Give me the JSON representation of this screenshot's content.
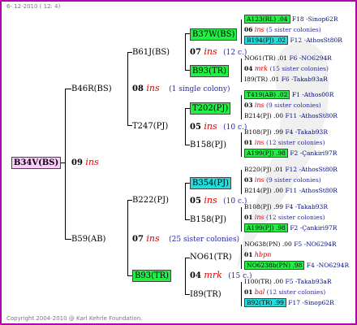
{
  "header": "6- 12-2010 ( 12: 4)",
  "footer": "Copyright 2004-2010 @ Karl Kehrle Foundation.",
  "root": {
    "id": "B34V(BS)",
    "gen": "09",
    "mark": "ins"
  },
  "l1": [
    {
      "id": "B46R(BS)",
      "gen": "08",
      "mark": "ins",
      "note": "(1 single colony)"
    },
    {
      "id": "B59(AB)",
      "gen": "07",
      "mark": "ins",
      "note": "(25 sister colonies)"
    }
  ],
  "l2": [
    {
      "id": "B61J(BS)",
      "gen": "07",
      "mark": "ins",
      "note": "(12 c.)"
    },
    {
      "id": "T247(PJ)",
      "gen": "05",
      "mark": "ins",
      "note": "(10 c.)"
    },
    {
      "id": "B222(PJ)",
      "gen": "05",
      "mark": "ins",
      "note": "(10 c.)"
    },
    {
      "id": "B93(TR)",
      "gen": "04",
      "mark": "mrk",
      "note": "(15 c.)"
    }
  ],
  "l3": [
    {
      "id": "B37W(BS)"
    },
    {
      "id": "B93(TR)"
    },
    {
      "id": "T202(PJ)"
    },
    {
      "id": "B158(PJ)"
    },
    {
      "id": "B354(PJ)"
    },
    {
      "id": "B158(PJ)"
    },
    {
      "id": "NO61(TR)"
    },
    {
      "id": "I89(TR)"
    }
  ],
  "l4": [
    {
      "a": "A123(RL) .04",
      "b": "F18 -Sinop62R",
      "gen": "06",
      "mark": "ins",
      "note": "(5 sister colonies)",
      "c": "B194(PJ) .02",
      "d": "F12 -AthosSt80R"
    },
    {
      "a": "NO61(TR) .01",
      "b": "F6 -NO6294R",
      "gen": "04",
      "mark": "mrk",
      "note": "(15 sister colonies)",
      "c": "I89(TR) .01",
      "d": "F6 -Takab93aR"
    },
    {
      "a": "T419(AB) .02",
      "b": "F1 -Athos00R",
      "gen": "03",
      "mark": "ins",
      "note": "(9 sister colonies)",
      "c": "B214(PJ) .00",
      "d": "F11 -AthosSt80R"
    },
    {
      "a": "B108(PJ) .99",
      "b": "F4 -Takab93R",
      "gen": "01",
      "mark": "ins",
      "note": "(12 sister colonies)",
      "c": "A199(PJ) .98",
      "d": "F2 -Çankiri97R"
    },
    {
      "a": "B220(PJ) .01",
      "b": "F12 -AthosSt80R",
      "gen": "03",
      "mark": "ins",
      "note": "(9 sister colonies)",
      "c": "B214(PJ) .00",
      "d": "F11 -AthosSt80R"
    },
    {
      "a": "B108(PJ) .99",
      "b": "F4 -Takab93R",
      "gen": "01",
      "mark": "ins",
      "note": "(12 sister colonies)",
      "c": "A199(PJ) .98",
      "d": "F2 -Çankiri97R"
    },
    {
      "a": "NO638(PN) .00",
      "b": "F5 -NO6294R",
      "gen": "01",
      "mark": "hbpn",
      "note": "",
      "c": "NO6238b(PN) .98",
      "d": "F4 -NO6294R"
    },
    {
      "a": "I100(TR) .00",
      "b": "F5 -Takab93aR",
      "gen": "01",
      "mark": "bal",
      "note": "(12 sister colonies)",
      "c": "B92(TR) .99",
      "d": "F17 -Sinop62R"
    }
  ]
}
